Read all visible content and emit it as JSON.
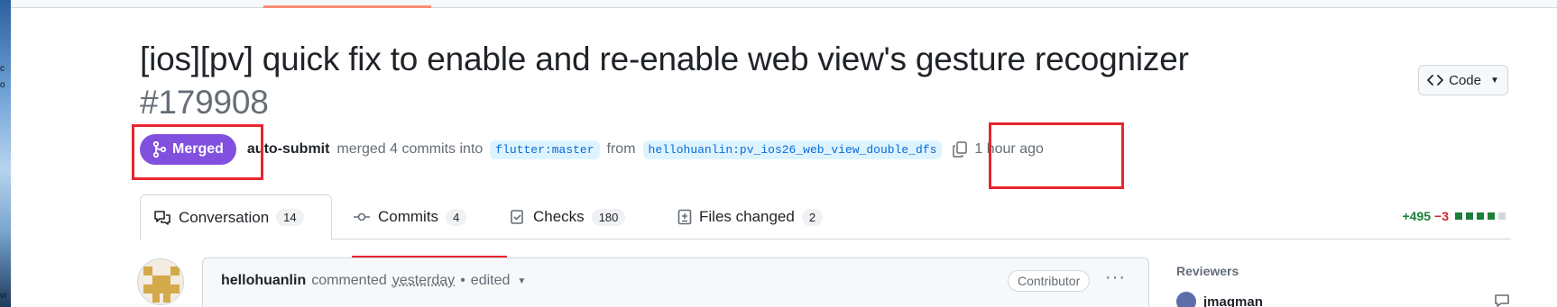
{
  "desktop": {
    "left_snippets": [
      "c",
      "o",
      "vi"
    ]
  },
  "pr": {
    "title": "[ios][pv] quick fix to enable and re-enable web view's gesture recognizer",
    "number": "#179908",
    "code_button": "Code",
    "state": "Merged",
    "actor": "auto-submit",
    "merge_text": "merged 4 commits into",
    "base_branch": "flutter:master",
    "from_text": "from",
    "head_branch": "hellohuanlin:pv_ios26_web_view_double_dfs",
    "time_ago": "1 hour ago"
  },
  "tabs": [
    {
      "label": "Conversation",
      "count": "14",
      "icon": "comment-discussion-icon"
    },
    {
      "label": "Commits",
      "count": "4",
      "icon": "git-commit-icon"
    },
    {
      "label": "Checks",
      "count": "180",
      "icon": "checklist-icon"
    },
    {
      "label": "Files changed",
      "count": "2",
      "icon": "file-diff-icon"
    }
  ],
  "diffstat": {
    "additions": "+495",
    "deletions": "−3"
  },
  "comment": {
    "author": "hellohuanlin",
    "verb": "commented",
    "time": "yesterday",
    "separator": "•",
    "edited": "edited",
    "badge": "Contributor"
  },
  "sidebar": {
    "reviewers_heading": "Reviewers",
    "reviewer_name": "jmagman"
  },
  "colors": {
    "merged": "#8250df",
    "annotation": "#e8252e",
    "additions": "#1a7f37",
    "deletions": "#cf222e",
    "link": "#0969da"
  }
}
